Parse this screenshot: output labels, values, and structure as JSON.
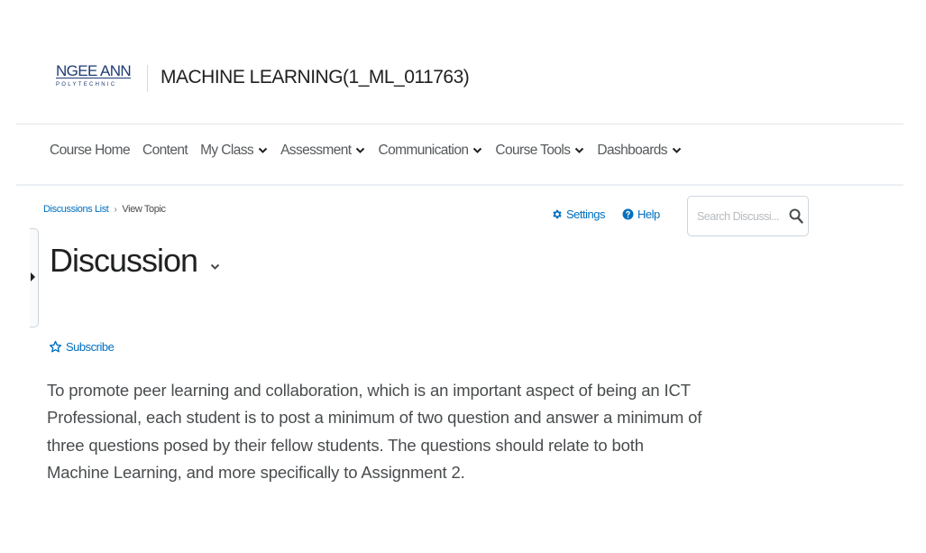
{
  "header": {
    "logo_main": "NGEE ANN",
    "logo_sub": "POLYTECHNIC",
    "course_title": "MACHINE LEARNING(1_ML_011763)"
  },
  "nav": {
    "items": [
      {
        "label": "Course Home",
        "has_dropdown": false
      },
      {
        "label": "Content",
        "has_dropdown": false
      },
      {
        "label": "My Class",
        "has_dropdown": true
      },
      {
        "label": "Assessment",
        "has_dropdown": true
      },
      {
        "label": "Communication",
        "has_dropdown": true
      },
      {
        "label": "Course Tools",
        "has_dropdown": true
      },
      {
        "label": "Dashboards",
        "has_dropdown": true
      }
    ]
  },
  "breadcrumb": {
    "parent": "Discussions List",
    "current": "View Topic"
  },
  "toolbar": {
    "settings_label": "Settings",
    "help_label": "Help",
    "search_placeholder": "Search Discussi..."
  },
  "page": {
    "title": "Discussion",
    "subscribe_label": "Subscribe",
    "description": "To promote peer learning and collaboration, which is an important aspect of being an ICT Professional, each student is to post a minimum of two question and answer a minimum of three questions posed by their fellow students. The questions should relate to both Machine Learning, and more specifically to Assignment 2."
  },
  "colors": {
    "link": "#006fbf",
    "text": "#494c4e",
    "heading": "#202122",
    "logo": "#1f3b73"
  }
}
